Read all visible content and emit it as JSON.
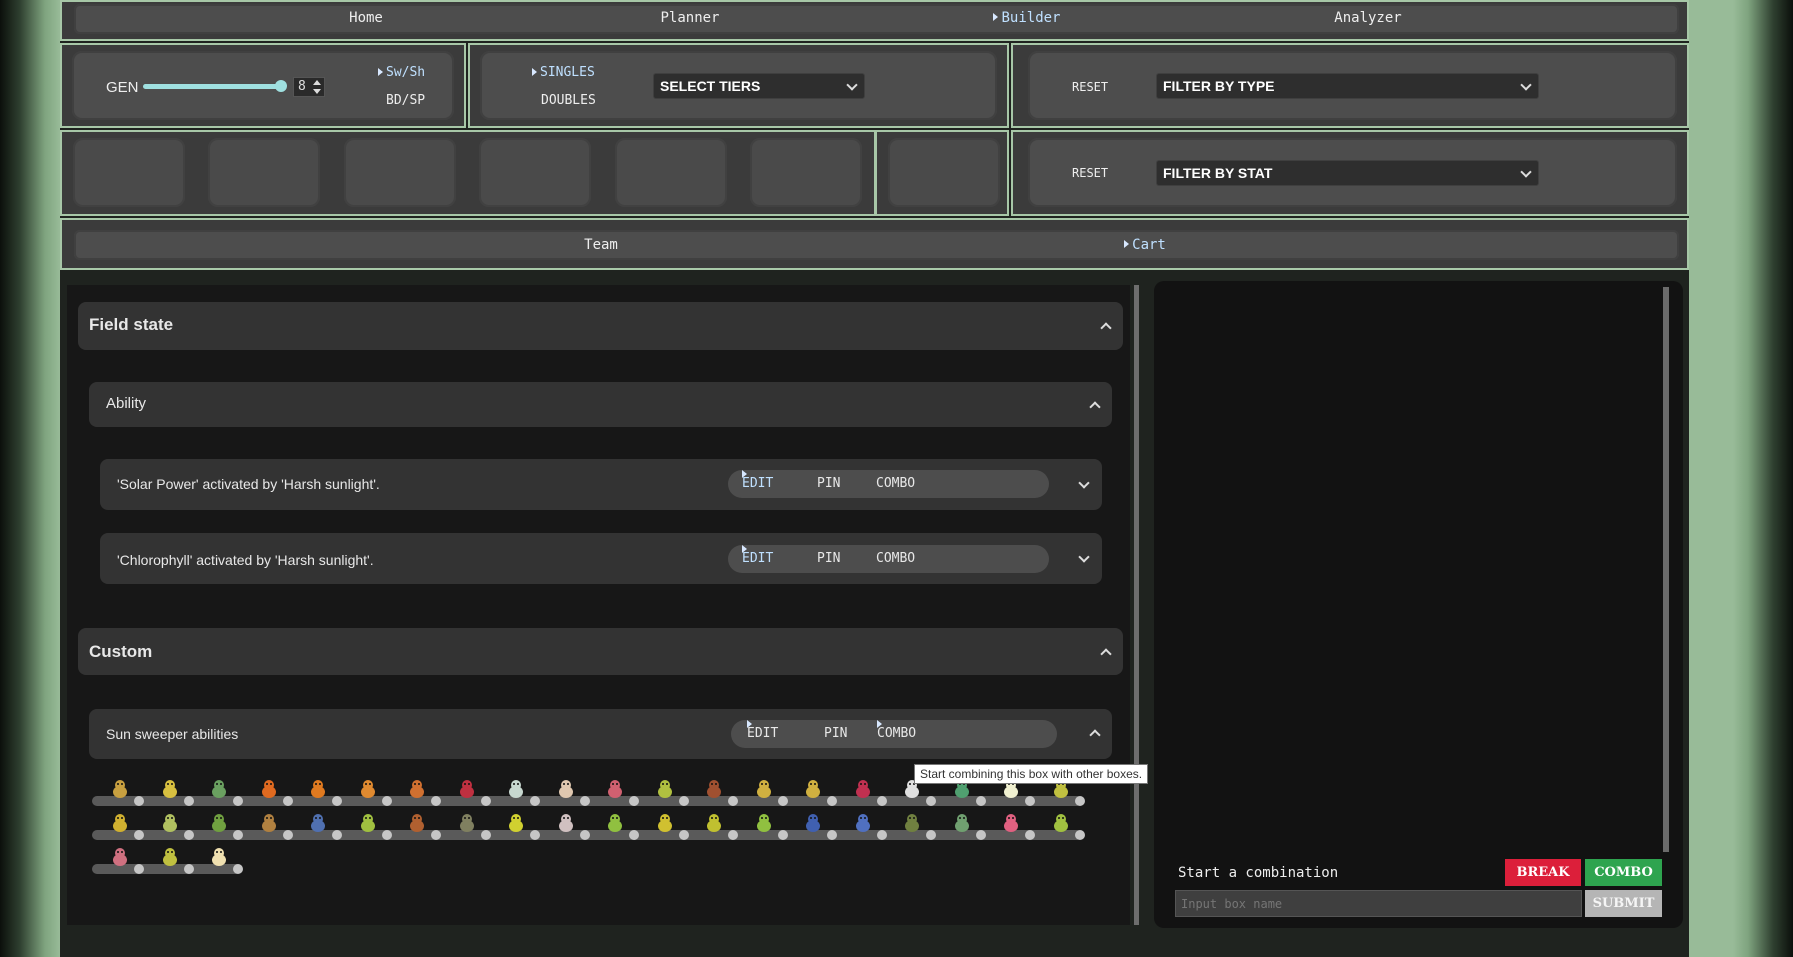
{
  "nav": {
    "items": [
      {
        "label": "Home",
        "active": false
      },
      {
        "label": "Planner",
        "active": false
      },
      {
        "label": "Builder",
        "active": true
      },
      {
        "label": "Analyzer",
        "active": false
      }
    ]
  },
  "gen": {
    "label": "GEN",
    "value": "8",
    "slider_fraction": 1.0,
    "games": [
      {
        "label": "Sw/Sh",
        "active": true
      },
      {
        "label": "BD/SP",
        "active": false
      }
    ]
  },
  "format": {
    "options": [
      {
        "label": "SINGLES",
        "active": true
      },
      {
        "label": "DOUBLES",
        "active": false
      }
    ],
    "tiers_select": "SELECT TIERS"
  },
  "type_filter": {
    "reset_label": "RESET",
    "select": "FILTER BY TYPE"
  },
  "stat_filter": {
    "reset_label": "RESET",
    "select": "FILTER BY STAT"
  },
  "tabs": [
    {
      "label": "Team",
      "active": false
    },
    {
      "label": "Cart",
      "active": true
    }
  ],
  "field_state": {
    "title": "Field state",
    "ability": {
      "title": "Ability",
      "entries": [
        {
          "text": "'Solar Power' activated by 'Harsh sunlight'.",
          "edit": "EDIT",
          "pin": "PIN",
          "combo": "COMBO"
        },
        {
          "text": "'Chlorophyll' activated by 'Harsh sunlight'.",
          "edit": "EDIT",
          "pin": "PIN",
          "combo": "COMBO"
        }
      ]
    }
  },
  "custom": {
    "title": "Custom",
    "box": {
      "title": "Sun sweeper abilities",
      "edit": "EDIT",
      "pin": "PIN",
      "combo": "COMBO"
    },
    "tooltip": "Start combining this box with other boxes.",
    "sprite_rows": [
      {
        "count": 20,
        "colors": [
          "#c8a040",
          "#d8c040",
          "#6aa060",
          "#e06a20",
          "#e07a20",
          "#e08a30",
          "#d07030",
          "#c03040",
          "#c8d8d0",
          "#e0c8b0",
          "#d06070",
          "#b0c040",
          "#a05030",
          "#d0b040",
          "#d0b040",
          "#c03050",
          "#e0e0e0",
          "#50a070",
          "#f0f0d0",
          "#c0c040"
        ]
      },
      {
        "count": 20,
        "colors": [
          "#d0b030",
          "#b0c060",
          "#70a040",
          "#b08040",
          "#5070b0",
          "#a0c040",
          "#b06030",
          "#808060",
          "#d0d030",
          "#d0c0c0",
          "#90c040",
          "#d0c030",
          "#c0c030",
          "#90c040",
          "#4060b0",
          "#5070c0",
          "#708040",
          "#70a070",
          "#e06080",
          "#a0c040"
        ]
      },
      {
        "count": 3,
        "colors": [
          "#d07080",
          "#c0c040",
          "#f0e0b0"
        ]
      }
    ]
  },
  "combination": {
    "label": "Start a combination",
    "break_label": "BREAK",
    "combo_label": "COMBO",
    "input_placeholder": "Input box name",
    "submit_label": "SUBMIT",
    "break_color": "#dc1f3a",
    "combo_color": "#2ea44f"
  }
}
